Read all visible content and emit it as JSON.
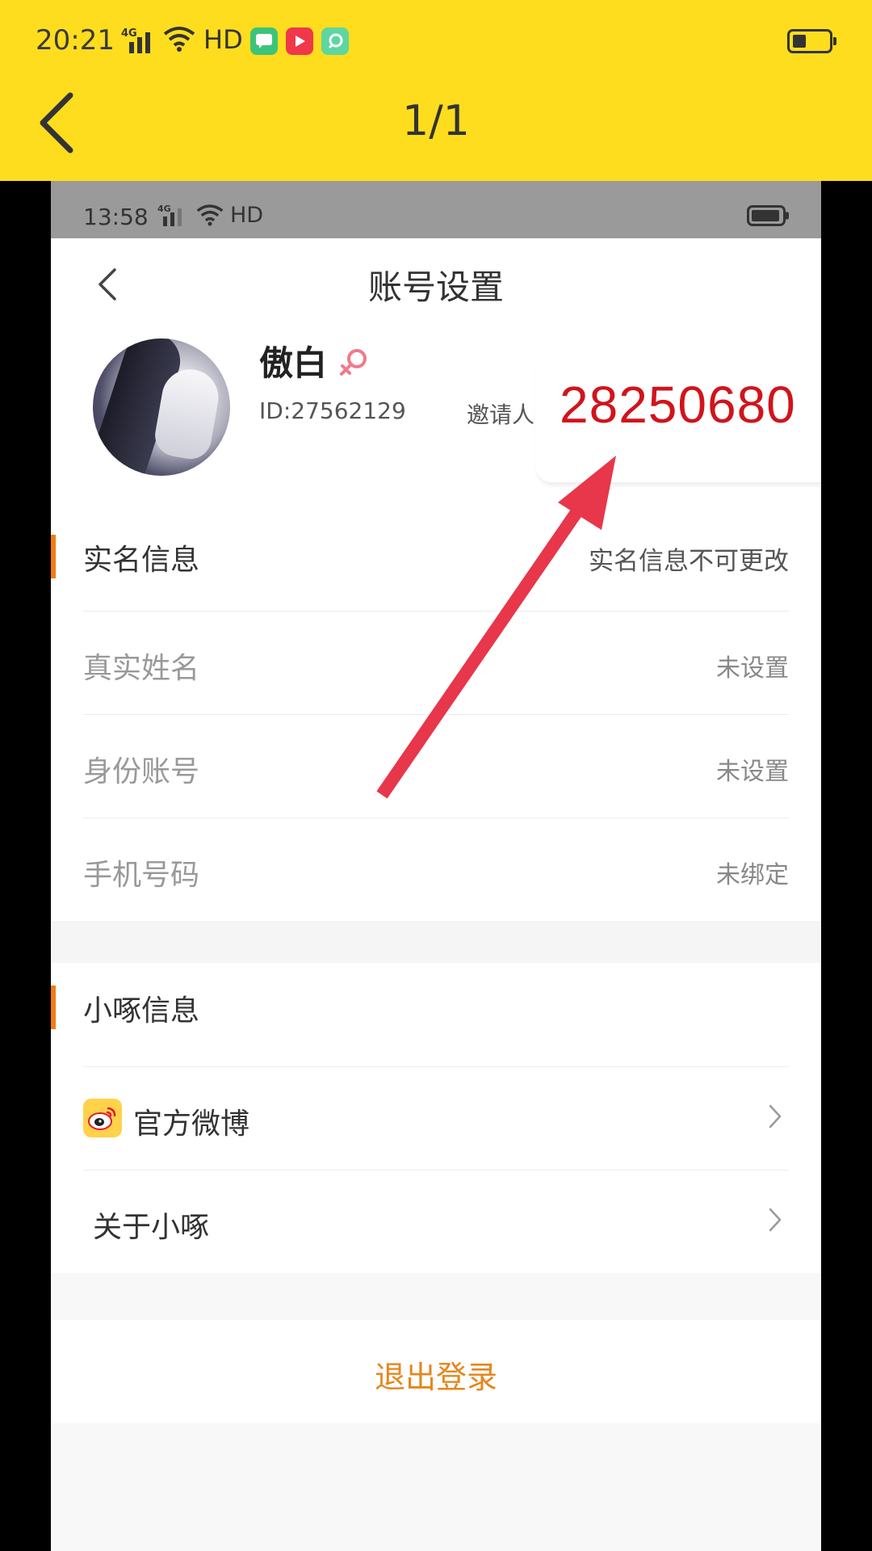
{
  "viewer": {
    "status_time": "20:21",
    "network": "4G",
    "hd": "HD",
    "page_counter": "1/1",
    "colors": {
      "bar_bg": "#FEDD1F"
    }
  },
  "screenshot": {
    "status_time": "13:58",
    "network": "4G",
    "hd": "HD",
    "title": "账号设置",
    "profile": {
      "name": "傲白",
      "id": "ID:27562129",
      "inviter_label": "邀请人",
      "inviter_code": "28250680"
    },
    "realname_section": {
      "title": "实名信息",
      "note": "实名信息不可更改",
      "rows": [
        {
          "label": "真实姓名",
          "value": "未设置"
        },
        {
          "label": "身份账号",
          "value": "未设置"
        },
        {
          "label": "手机号码",
          "value": "未绑定"
        }
      ]
    },
    "app_section": {
      "title": "小啄信息",
      "rows": [
        {
          "label": "官方微博",
          "icon": "weibo-icon"
        },
        {
          "label": "关于小啄"
        }
      ]
    },
    "logout": "退出登录",
    "colors": {
      "accent_orange": "#F07C12",
      "logout_text": "#E5871E",
      "inviter_code": "#D0141C",
      "arrow": "#E8364A"
    }
  }
}
